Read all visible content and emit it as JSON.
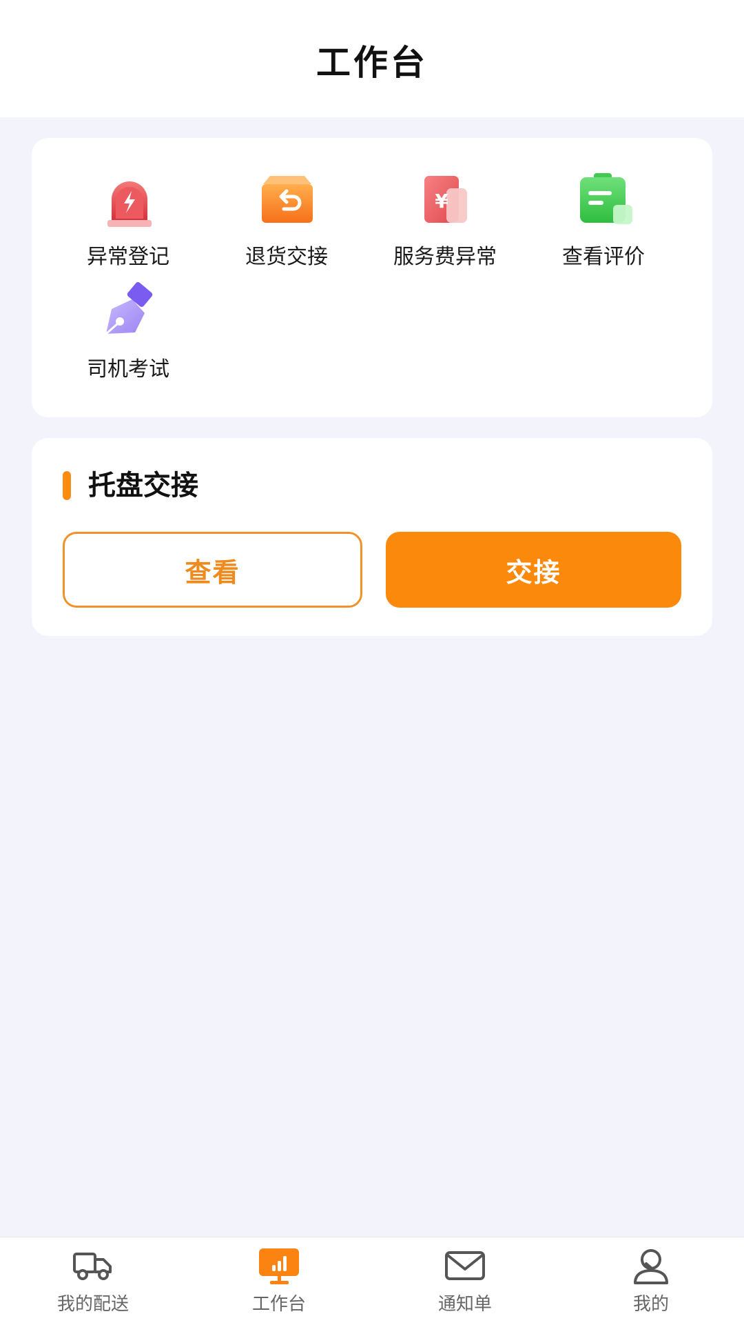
{
  "header": {
    "title": "工作台"
  },
  "tools": [
    {
      "label": "异常登记",
      "icon": "alarm-light-icon"
    },
    {
      "label": "退货交接",
      "icon": "return-box-icon"
    },
    {
      "label": "服务费异常",
      "icon": "yuan-document-icon"
    },
    {
      "label": "查看评价",
      "icon": "clipboard-review-icon"
    },
    {
      "label": "司机考试",
      "icon": "pen-nib-icon"
    }
  ],
  "pallet_handover": {
    "title": "托盘交接",
    "view_label": "查看",
    "handover_label": "交接"
  },
  "tabbar": {
    "items": [
      {
        "label": "我的配送",
        "icon": "truck-icon",
        "active": false
      },
      {
        "label": "工作台",
        "icon": "dashboard-icon",
        "active": true
      },
      {
        "label": "通知单",
        "icon": "mail-icon",
        "active": false
      },
      {
        "label": "我的",
        "icon": "user-icon",
        "active": false
      }
    ]
  },
  "colors": {
    "accent": "#fb890c",
    "background": "#f3f3fc",
    "alarm_red": "#e8474d",
    "return_orange": "#fb7d18",
    "fee_red": "#f25c5c",
    "review_green": "#3ccc4a",
    "exam_purple": "#9d86f5"
  }
}
